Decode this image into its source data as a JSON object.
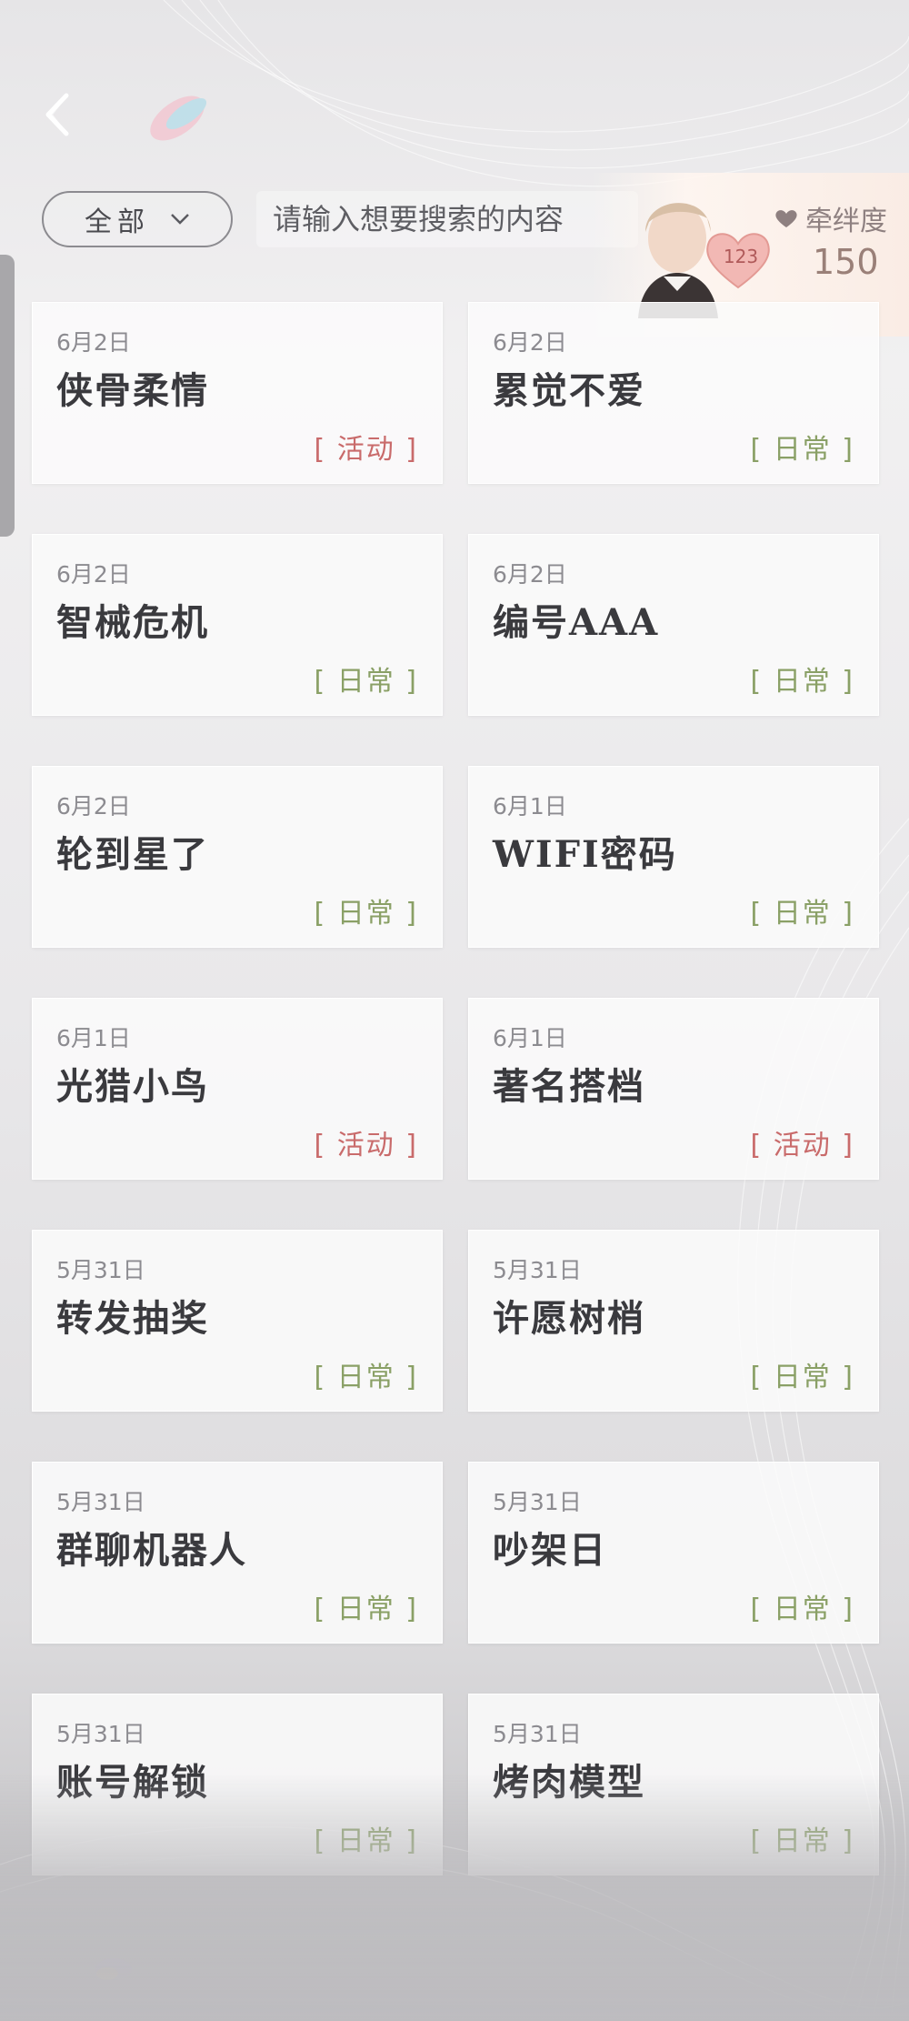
{
  "header": {
    "filter_label": "全部",
    "search_placeholder": "请输入想要搜索的内容"
  },
  "bond": {
    "label": "牵绊度",
    "value": "150",
    "level": "123"
  },
  "colors": {
    "event_tag": "#c96b6b",
    "daily_tag": "#8aa066"
  },
  "cards": [
    {
      "date": "6月2日",
      "title": "侠骨柔情",
      "tag": "[ 活动 ]",
      "type": "event"
    },
    {
      "date": "6月2日",
      "title": "累觉不爱",
      "tag": "[ 日常 ]",
      "type": "daily"
    },
    {
      "date": "6月2日",
      "title": "智械危机",
      "tag": "[ 日常 ]",
      "type": "daily"
    },
    {
      "date": "6月2日",
      "title": "编号AAA",
      "tag": "[ 日常 ]",
      "type": "daily"
    },
    {
      "date": "6月2日",
      "title": "轮到星了",
      "tag": "[ 日常 ]",
      "type": "daily"
    },
    {
      "date": "6月1日",
      "title": "WIFI密码",
      "tag": "[ 日常 ]",
      "type": "daily"
    },
    {
      "date": "6月1日",
      "title": "光猎小鸟",
      "tag": "[ 活动 ]",
      "type": "event"
    },
    {
      "date": "6月1日",
      "title": "著名搭档",
      "tag": "[ 活动 ]",
      "type": "event"
    },
    {
      "date": "5月31日",
      "title": "转发抽奖",
      "tag": "[ 日常 ]",
      "type": "daily"
    },
    {
      "date": "5月31日",
      "title": "许愿树梢",
      "tag": "[ 日常 ]",
      "type": "daily"
    },
    {
      "date": "5月31日",
      "title": "群聊机器人",
      "tag": "[ 日常 ]",
      "type": "daily"
    },
    {
      "date": "5月31日",
      "title": "吵架日",
      "tag": "[ 日常 ]",
      "type": "daily"
    },
    {
      "date": "5月31日",
      "title": "账号解锁",
      "tag": "[ 日常 ]",
      "type": "daily"
    },
    {
      "date": "5月31日",
      "title": "烤肉模型",
      "tag": "[ 日常 ]",
      "type": "daily"
    }
  ]
}
